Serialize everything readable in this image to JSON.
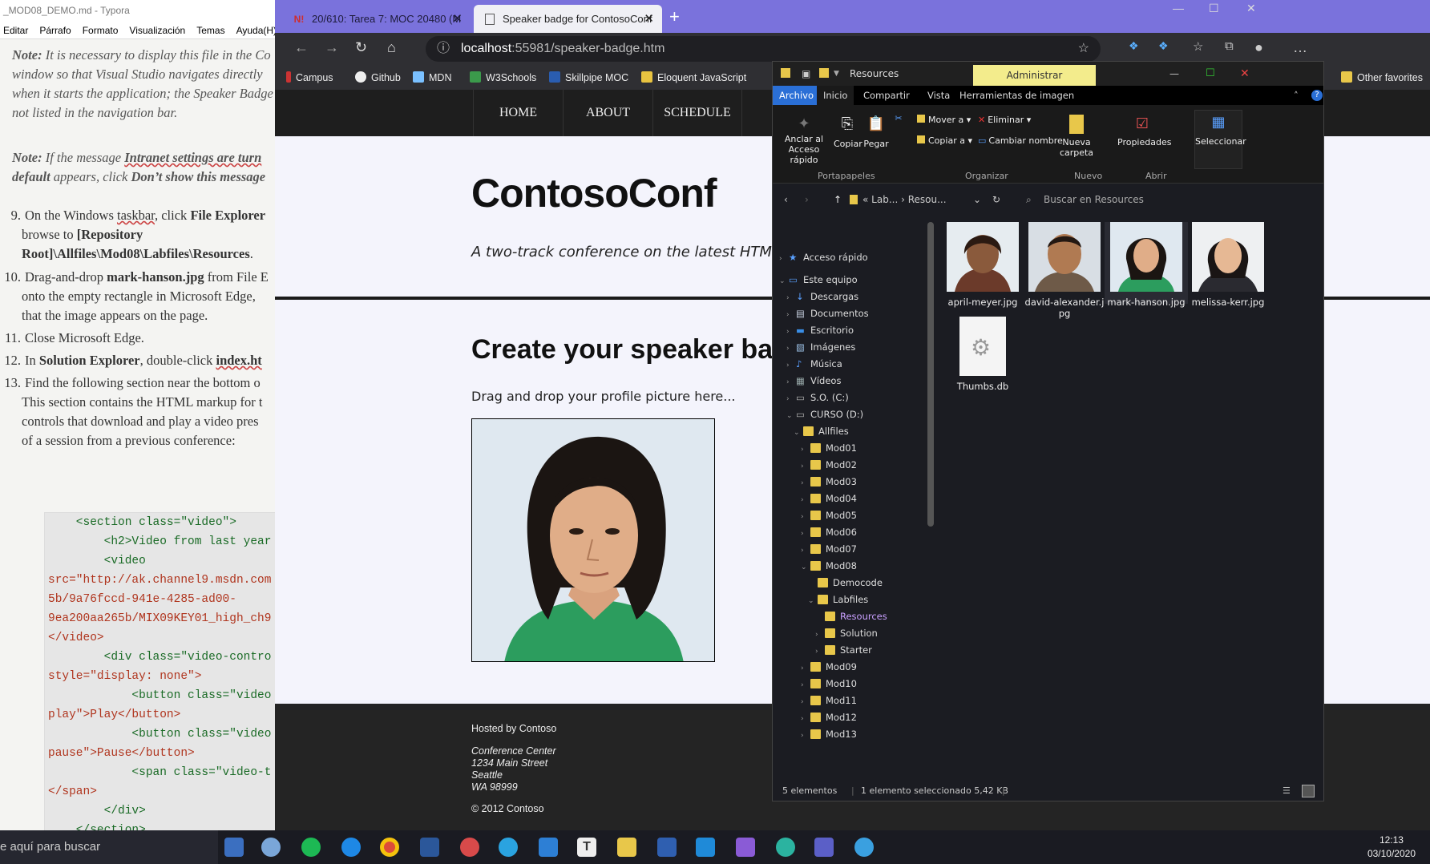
{
  "typora": {
    "title": "_MOD08_DEMO.md - Typora",
    "menu": [
      "Editar",
      "Párrafo",
      "Formato",
      "Visualización",
      "Temas",
      "Ayuda(H)"
    ],
    "note1_lines": [
      "It is necessary to display this file in the Co",
      "window so that Visual Studio navigates directly",
      "when it starts the application; the Speaker Badge",
      "not listed in the navigation bar."
    ],
    "note_label": "Note:",
    "note2_line1": "If the message ",
    "note2_bold": "Intranet settings are turn",
    "note2_line2a": "default",
    "note2_line2b": " appears, click ",
    "note2_line2c": "Don’t show this message",
    "items": [
      {
        "n": "9.",
        "l1a": "On the Windows ",
        "l1b": "taskbar",
        "l1c": ", click ",
        "l1d": "File Explorer",
        "l2a": "browse to ",
        "l2b": "[Repository",
        "l3": "Root]\\Allfiles\\Mod08\\Labfiles\\Resources",
        "l3e": "."
      },
      {
        "n": "10.",
        "l1a": "Drag-and-drop ",
        "l1b": "mark-hanson.jpg",
        "l1c": " from File E",
        "l2": "onto the empty rectangle in Microsoft Edge, ",
        "l3": "that the image appears on the page."
      },
      {
        "n": "11.",
        "l1": "Close Microsoft Edge."
      },
      {
        "n": "12.",
        "l1a": "In ",
        "l1b": "Solution Explorer",
        "l1c": ", double-click ",
        "l1d": "index.ht"
      },
      {
        "n": "13.",
        "l1": "Find the following section near the bottom o",
        "l2": "This section contains the HTML markup for t",
        "l3": "controls that download and play a video pres",
        "l4": "of a session from a previous conference:"
      }
    ],
    "code": [
      "    <section class=\"video\">",
      "        <h2>Video from last year",
      "        <video",
      "src=\"http://ak.channel9.msdn.com",
      "5b/9a76fccd-941e-4285-ad00-",
      "9ea200aa265b/MIX09KEY01_high_ch9",
      "</video>",
      "        <div class=\"video-contro",
      "style=\"display: none\">",
      "            <button class=\"video",
      "play\">Play</button>",
      "            <button class=\"video",
      "pause\">Pause</button>",
      "            <span class=\"video-t",
      "</span>",
      "        </div>",
      "    </section>"
    ]
  },
  "edge": {
    "tab1": "20/610: Tarea 7: MOC 20480 (M",
    "tab2": "Speaker badge for ContosoConf",
    "url_host": "localhost",
    "url_path": ":55981/speaker-badge.htm",
    "favorites": [
      "Campus",
      "Github",
      "MDN",
      "W3Schools",
      "Skillpipe MOC",
      "Eloquent JavaScript"
    ],
    "other_favorites": "Other favorites"
  },
  "site": {
    "nav": [
      "HOME",
      "ABOUT",
      "SCHEDULE"
    ],
    "brand": "ContosoConf",
    "tagline": "A two-track conference on the latest HTML5 de",
    "heading": "Create your speaker bad",
    "drop_text": "Drag and drop your profile picture here...",
    "footer": {
      "hosted": "Hosted by Contoso",
      "addr1": "Conference Center",
      "addr2": "1234 Main Street",
      "addr3": "Seattle",
      "addr4": "WA 98999",
      "copy": "© 2012 Contoso"
    }
  },
  "explorer": {
    "title": "Resources",
    "admin": "Administrar",
    "tabs": [
      "Archivo",
      "Inicio",
      "Compartir",
      "Vista",
      "Herramientas de imagen"
    ],
    "ribbon": {
      "pin1": "Anclar al",
      "pin2": "Acceso rápido",
      "copy": "Copiar",
      "paste": "Pegar",
      "move": "Mover a",
      "copyto": "Copiar a",
      "delete": "Eliminar",
      "rename": "Cambiar nombre",
      "newf1": "Nueva",
      "newf2": "carpeta",
      "props": "Propiedades",
      "select": "Seleccionar",
      "groups": [
        "Portapapeles",
        "Organizar",
        "Nuevo",
        "Abrir"
      ]
    },
    "path1": "Lab...",
    "path2": "Resou...",
    "search": "Buscar en Resources",
    "tree": [
      {
        "label": "Acceso rápido",
        "depth": 0,
        "type": "star"
      },
      {
        "label": "Este equipo",
        "depth": 0,
        "type": "pc"
      },
      {
        "label": "Descargas",
        "depth": 1,
        "type": "down"
      },
      {
        "label": "Documentos",
        "depth": 1,
        "type": "doc"
      },
      {
        "label": "Escritorio",
        "depth": 1,
        "type": "desk"
      },
      {
        "label": "Imágenes",
        "depth": 1,
        "type": "img"
      },
      {
        "label": "Música",
        "depth": 1,
        "type": "music"
      },
      {
        "label": "Vídeos",
        "depth": 1,
        "type": "video"
      },
      {
        "label": "S.O. (C:)",
        "depth": 1,
        "type": "drive"
      },
      {
        "label": "CURSO (D:)",
        "depth": 1,
        "type": "drive"
      },
      {
        "label": "Allfiles",
        "depth": 2,
        "type": "folder"
      },
      {
        "label": "Mod01",
        "depth": 3,
        "type": "folder"
      },
      {
        "label": "Mod02",
        "depth": 3,
        "type": "folder"
      },
      {
        "label": "Mod03",
        "depth": 3,
        "type": "folder"
      },
      {
        "label": "Mod04",
        "depth": 3,
        "type": "folder"
      },
      {
        "label": "Mod05",
        "depth": 3,
        "type": "folder"
      },
      {
        "label": "Mod06",
        "depth": 3,
        "type": "folder"
      },
      {
        "label": "Mod07",
        "depth": 3,
        "type": "folder"
      },
      {
        "label": "Mod08",
        "depth": 3,
        "type": "folder"
      },
      {
        "label": "Democode",
        "depth": 4,
        "type": "folder"
      },
      {
        "label": "Labfiles",
        "depth": 4,
        "type": "folder"
      },
      {
        "label": "Resources",
        "depth": 5,
        "type": "folder"
      },
      {
        "label": "Solution",
        "depth": 5,
        "type": "folder"
      },
      {
        "label": "Starter",
        "depth": 5,
        "type": "folder"
      },
      {
        "label": "Mod09",
        "depth": 3,
        "type": "folder"
      },
      {
        "label": "Mod10",
        "depth": 3,
        "type": "folder"
      },
      {
        "label": "Mod11",
        "depth": 3,
        "type": "folder"
      },
      {
        "label": "Mod12",
        "depth": 3,
        "type": "folder"
      },
      {
        "label": "Mod13",
        "depth": 3,
        "type": "folder"
      }
    ],
    "files": [
      "april-meyer.jpg",
      "david-alexander.j\npg",
      "mark-hanson.jpg",
      "melissa-kerr.jpg",
      "Thumbs.db"
    ],
    "status_count": "5 elementos",
    "status_sel": "1 elemento seleccionado  5,42 KB"
  },
  "taskbar": {
    "search": "e aquí para buscar",
    "time": "12:13",
    "date": "03/10/2020"
  }
}
